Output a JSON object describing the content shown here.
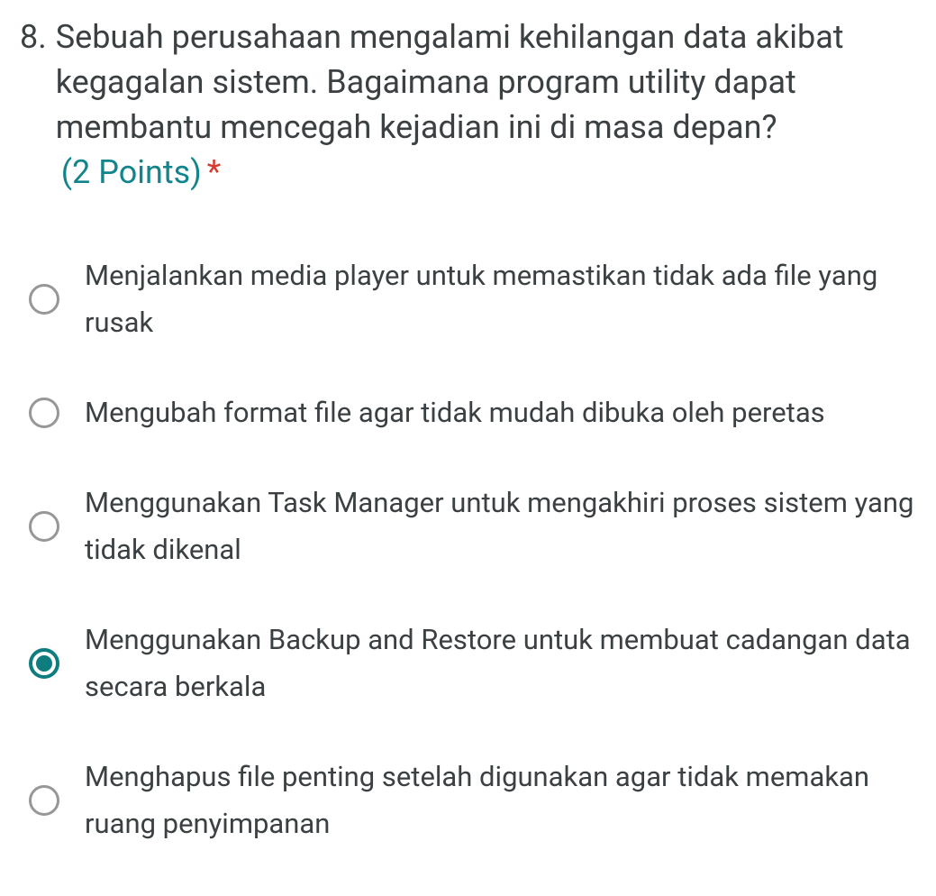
{
  "question": {
    "number": "8.",
    "text": "Sebuah perusahaan mengalami kehilangan data akibat kegagalan sistem. Bagaimana program utility dapat membantu mencegah kejadian ini di masa depan?",
    "points": "(2 Points)",
    "required_mark": "*",
    "options": [
      {
        "label": "Menjalankan media player untuk memastikan tidak ada file yang rusak",
        "selected": false
      },
      {
        "label": "Mengubah format file agar tidak mudah dibuka oleh peretas",
        "selected": false
      },
      {
        "label": "Menggunakan Task Manager untuk mengakhiri proses sistem yang tidak dikenal",
        "selected": false
      },
      {
        "label": "Menggunakan Backup and Restore untuk membuat cadangan data secara berkala",
        "selected": true
      },
      {
        "label": "Menghapus file penting setelah digunakan agar tidak memakan ruang penyimpanan",
        "selected": false
      }
    ]
  }
}
